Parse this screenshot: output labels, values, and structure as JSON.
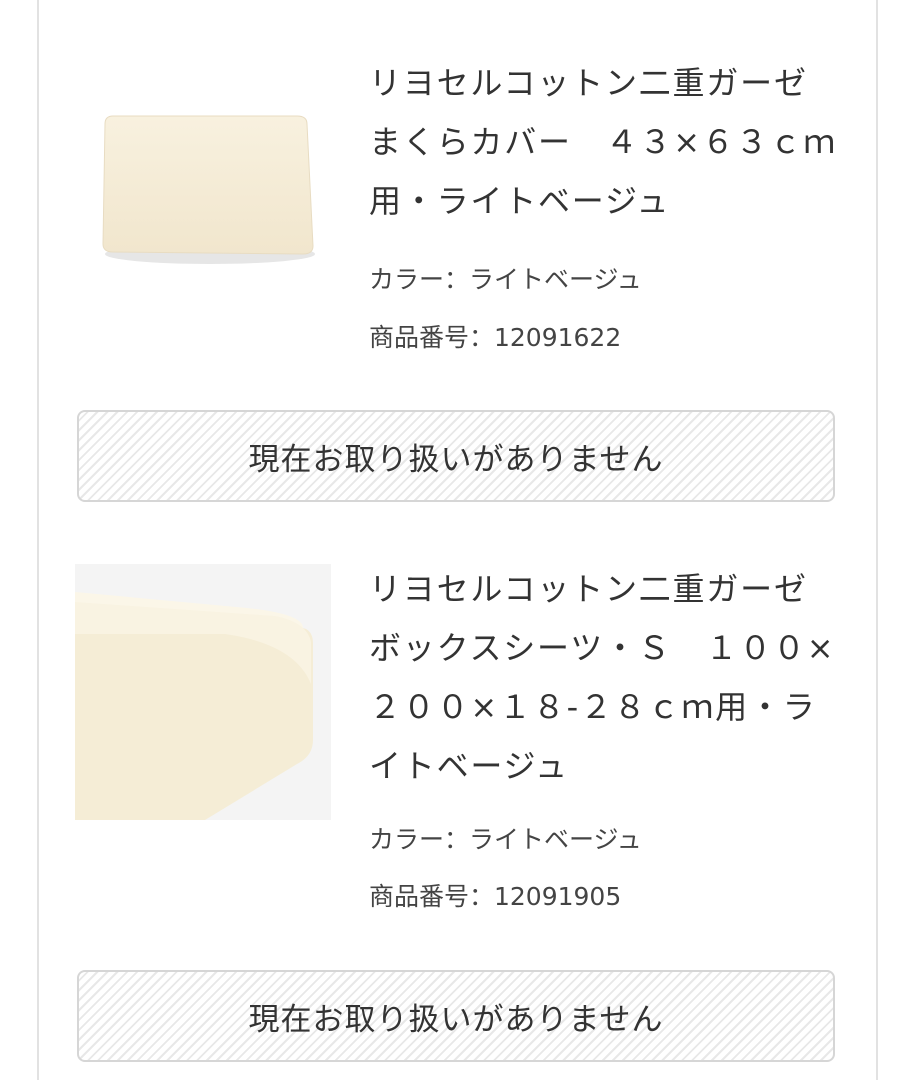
{
  "products": [
    {
      "title": "リヨセルコットン二重ガーゼまくらカバー　４３×６３ｃｍ用・ライトベージュ",
      "color_label": "カラー：ライトベージュ",
      "number_label": "商品番号：12091622",
      "status_label": "現在お取り扱いがありません",
      "image": "pillow-cover-light-beige"
    },
    {
      "title": "リヨセルコットン二重ガーゼボックスシーツ・Ｓ　１００×２００×１８-２８ｃｍ用・ライトベージュ",
      "color_label": "カラー：ライトベージュ",
      "number_label": "商品番号：12091905",
      "status_label": "現在お取り扱いがありません",
      "image": "box-sheet-light-beige"
    }
  ],
  "colors": {
    "background": "#ffffff",
    "text": "#333333",
    "button_border": "#d6d6d6",
    "stripe": "#e8e8e8",
    "product_beige": "#f6eedb"
  }
}
